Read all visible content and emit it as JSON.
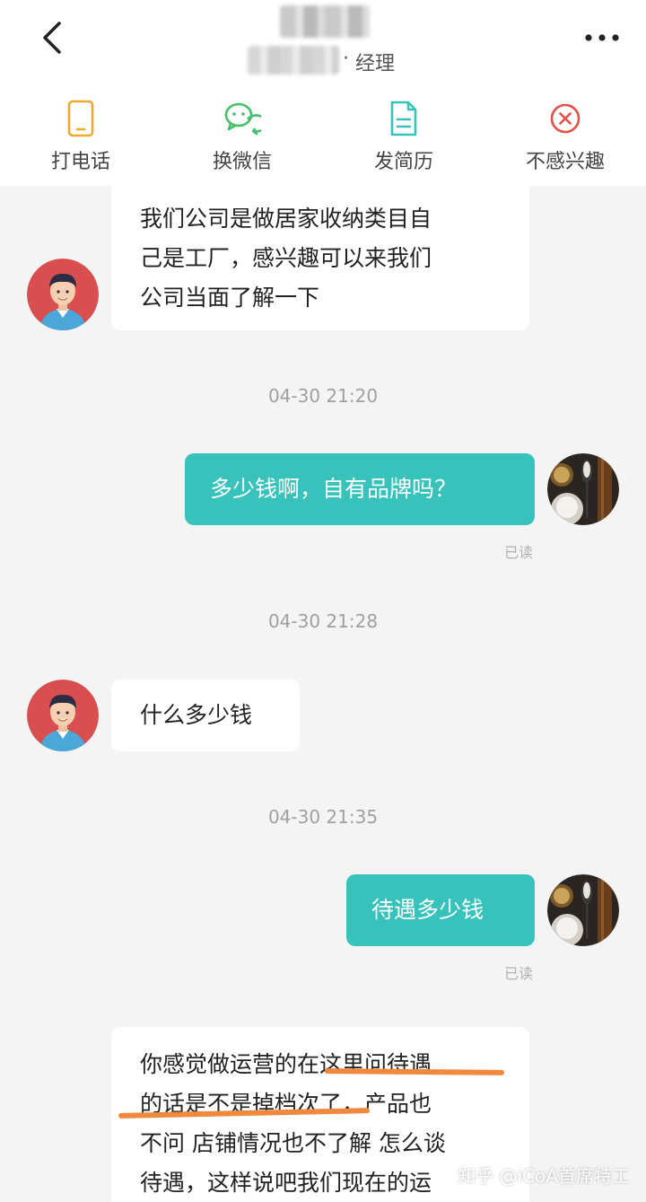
{
  "header": {
    "title_separator": "·",
    "title_role": "经理",
    "actions": [
      {
        "label": "打电话",
        "icon": "phone-icon",
        "color": "#f0a92f"
      },
      {
        "label": "换微信",
        "icon": "wechat-icon",
        "color": "#44c06a"
      },
      {
        "label": "发简历",
        "icon": "resume-icon",
        "color": "#37c2bb"
      },
      {
        "label": "不感兴趣",
        "icon": "not-interested-icon",
        "color": "#e5504a"
      }
    ]
  },
  "messages": {
    "m1_lines": [
      "我们公司是做居家收纳类目自",
      "己是工厂，感兴趣可以来我们",
      "公司当面了解一下"
    ],
    "t1": "04-30 21:20",
    "m2": "多少钱啊，自有品牌吗？",
    "read1": "已读",
    "t2": "04-30 21:28",
    "m3": "什么多少钱",
    "t3": "04-30 21:35",
    "m4": "待遇多少钱",
    "read2": "已读",
    "m5_lines": [
      "你感觉做运营的在这里问待遇",
      "的话是不是掉档次了，产品也",
      "不问 店铺情况也不了解 怎么谈",
      "待遇，这样说吧我们现在的运"
    ]
  },
  "watermark": "知乎 @iCoA首席特工",
  "colors": {
    "accent": "#37c2bb",
    "highlight": "#f0883d",
    "background": "#f4f4f4"
  }
}
